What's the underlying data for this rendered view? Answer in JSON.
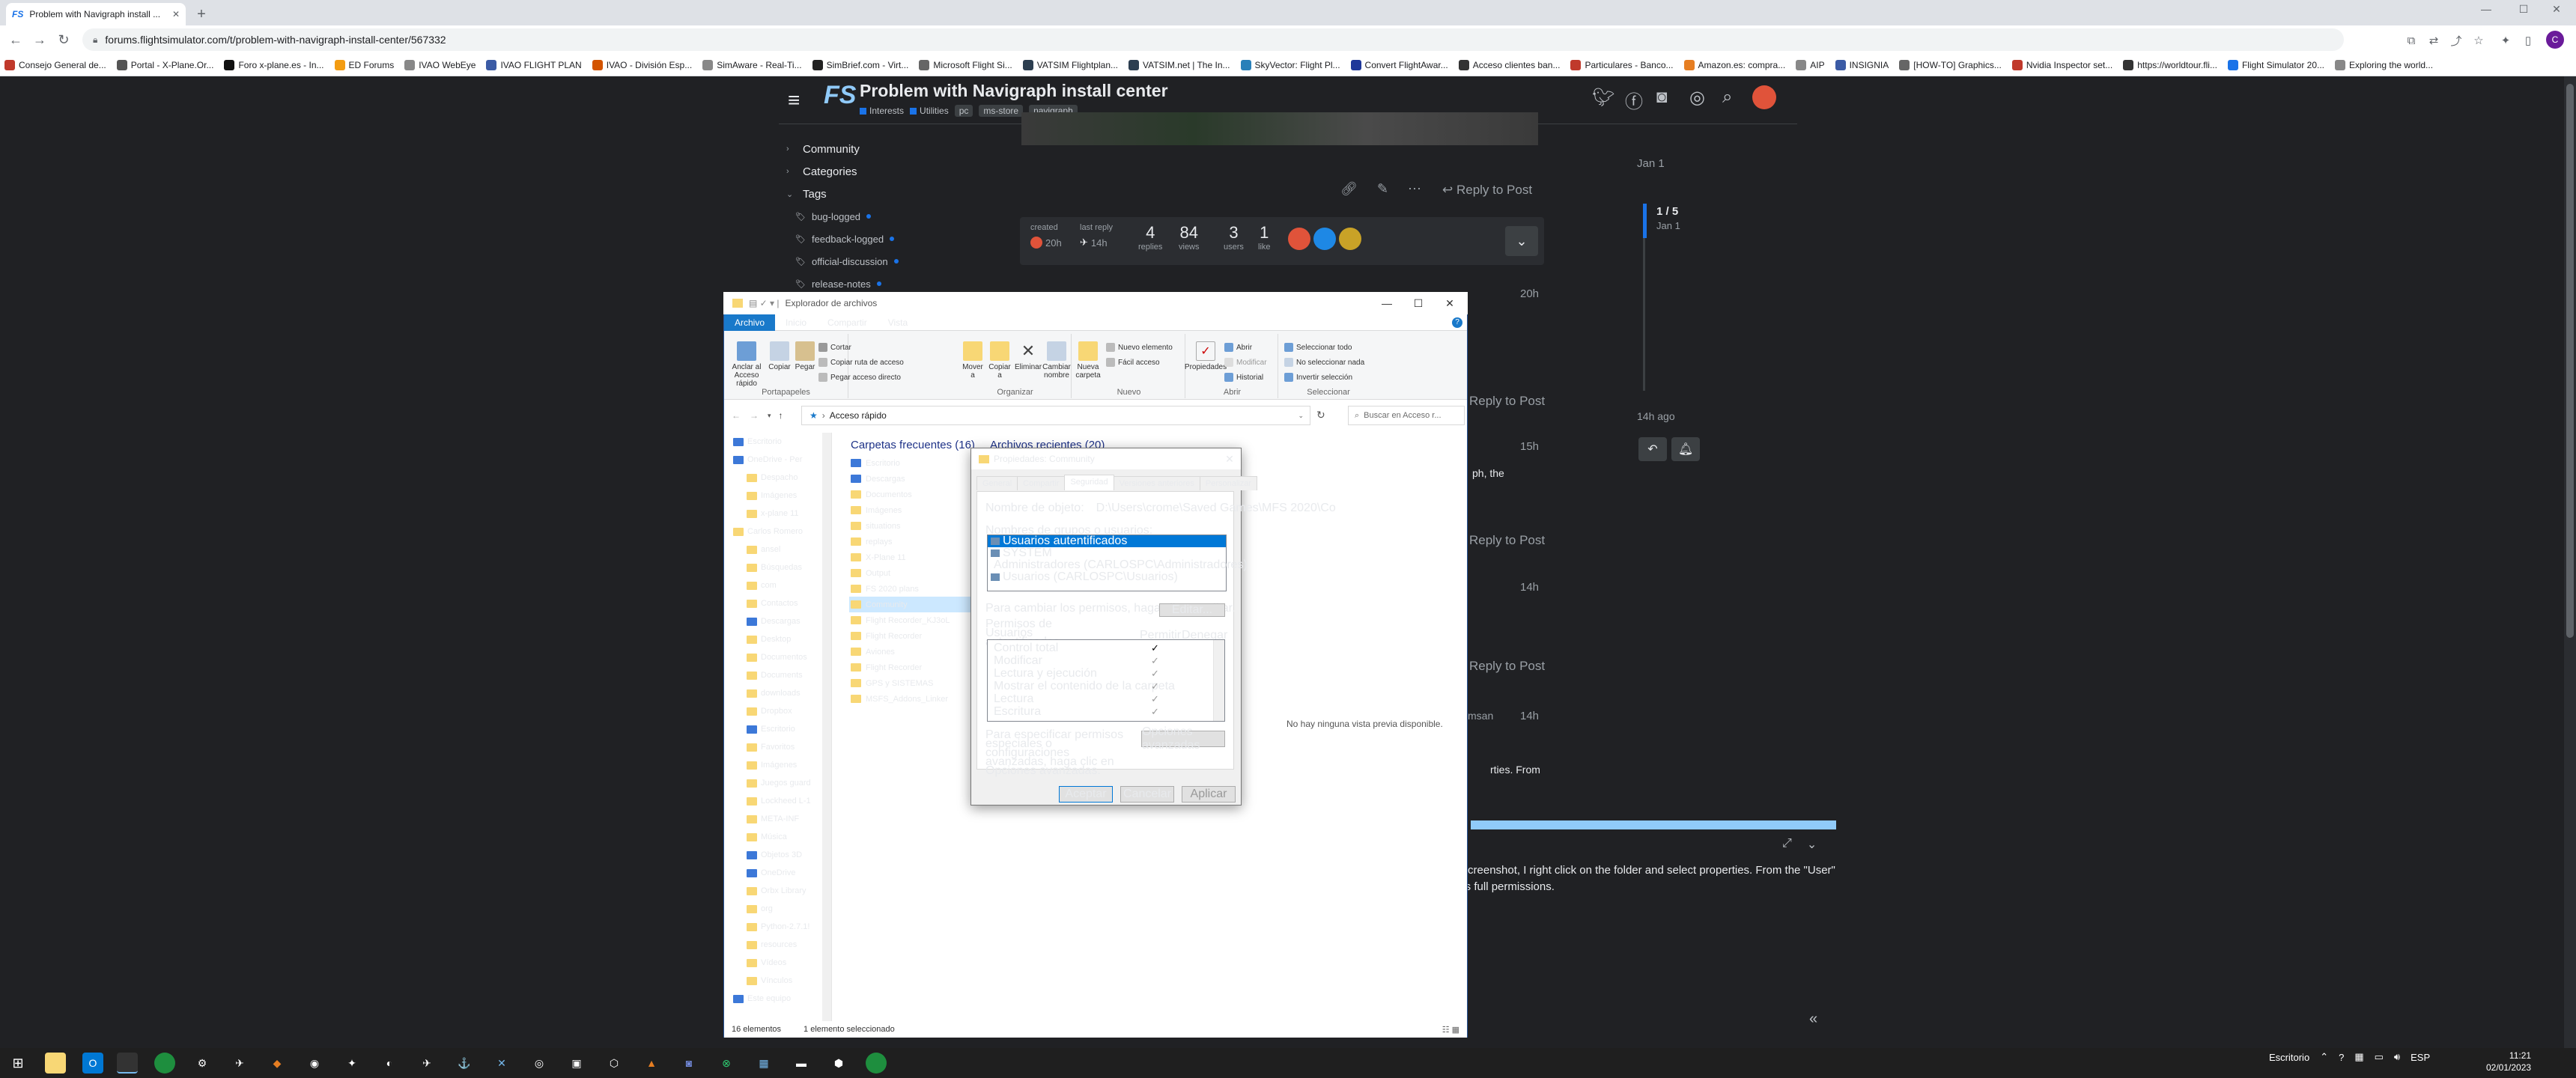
{
  "browser": {
    "tab_title": "Problem with Navigraph install ...",
    "url": "forums.flightsimulator.com/t/problem-with-navigraph-install-center/567332",
    "bookmarks": [
      {
        "label": "Consejo General de...",
        "color": "#c0392b"
      },
      {
        "label": "Portal - X-Plane.Or...",
        "color": "#555555"
      },
      {
        "label": "Foro x-plane.es - In...",
        "color": "#111111"
      },
      {
        "label": "ED Forums",
        "color": "#f39c12"
      },
      {
        "label": "IVAO WebEye",
        "color": "#888888"
      },
      {
        "label": "IVAO FLIGHT PLAN",
        "color": "#3b5ba5"
      },
      {
        "label": "IVAO - División Esp...",
        "color": "#d35400"
      },
      {
        "label": "SimAware - Real-Ti...",
        "color": "#888888"
      },
      {
        "label": "SimBrief.com - Virt...",
        "color": "#222222"
      },
      {
        "label": "Microsoft Flight Si...",
        "color": "#666666"
      },
      {
        "label": "VATSIM Flightplan...",
        "color": "#2c3e50"
      },
      {
        "label": "VATSIM.net | The In...",
        "color": "#2c3e50"
      },
      {
        "label": "SkyVector: Flight Pl...",
        "color": "#2980b9"
      },
      {
        "label": "Convert FlightAwar...",
        "color": "#1e3799"
      },
      {
        "label": "Acceso clientes ban...",
        "color": "#333333"
      },
      {
        "label": "Particulares - Banco...",
        "color": "#c0392b"
      },
      {
        "label": "Amazon.es: compra...",
        "color": "#e67e22"
      },
      {
        "label": "AIP",
        "color": "#888888"
      },
      {
        "label": "INSIGNIA",
        "color": "#3b5ba5"
      },
      {
        "label": "[HOW-TO] Graphics...",
        "color": "#666666"
      },
      {
        "label": "Nvidia Inspector set...",
        "color": "#c0392b"
      },
      {
        "label": "https://worldtour.fli...",
        "color": "#333333"
      },
      {
        "label": "Flight Simulator 20...",
        "color": "#1a73e8"
      },
      {
        "label": "Exploring the world...",
        "color": "#888888"
      }
    ],
    "avatar_letter": "C"
  },
  "forum": {
    "title": "Problem with Navigraph install center",
    "categories": [
      {
        "label": "Interests",
        "color": "#1a73e8"
      },
      {
        "label": "Utilities",
        "color": "#1a73e8"
      }
    ],
    "tags": [
      "pc",
      "ms-store",
      "navigraph"
    ],
    "sidebar": [
      "Community",
      "Categories",
      "Tags"
    ],
    "sidebar_tags": [
      "bug-logged",
      "feedback-logged",
      "official-discussion",
      "release-notes"
    ],
    "reply_label": "Reply to Post",
    "topic_map": {
      "created_label": "created",
      "created_time": "20h",
      "last_reply_label": "last reply",
      "last_reply_time": "14h",
      "replies": "4",
      "replies_label": "replies",
      "views": "84",
      "views_label": "views",
      "users": "3",
      "users_label": "users",
      "likes": "1",
      "likes_label": "like"
    },
    "post_times": [
      "20h",
      "15h",
      "14h",
      "14h"
    ],
    "partial_text_1": "ph, the",
    "partial_text_2": "rties. From",
    "author_partial": "msan",
    "timeline": {
      "top_date": "Jan 1",
      "count": "1 / 5",
      "date": "Jan 1",
      "ago": "14h ago"
    },
    "composer_text": "e screenshot, I right click on the folder and select properties. From the \"User\" has full permissions."
  },
  "explorer": {
    "title": "Explorador de archivos",
    "menu": [
      "Archivo",
      "Inicio",
      "Compartir",
      "Vista"
    ],
    "ribbon": {
      "portapapeles": {
        "label": "Portapapeles",
        "pin": "Anclar al Acceso rápido",
        "copy": "Copiar",
        "paste": "Pegar",
        "cut": "Cortar",
        "copy_path": "Copiar ruta de acceso",
        "paste_shortcut": "Pegar acceso directo"
      },
      "organizar": {
        "label": "Organizar",
        "move": "Mover a",
        "copy_to": "Copiar a",
        "delete": "Eliminar",
        "rename": "Cambiar nombre"
      },
      "nuevo": {
        "label": "Nuevo",
        "new_folder": "Nueva carpeta",
        "new_item": "Nuevo elemento",
        "easy_access": "Fácil acceso"
      },
      "abrir": {
        "label": "Abrir",
        "properties": "Propiedades",
        "open": "Abrir",
        "edit": "Modificar",
        "history": "Historial"
      },
      "seleccionar": {
        "label": "Seleccionar",
        "all": "Seleccionar todo",
        "none": "No seleccionar nada",
        "invert": "Invertir selección"
      }
    },
    "path": "Acceso rápido",
    "search_placeholder": "Buscar en Acceso r...",
    "tree": [
      {
        "label": "Escritorio",
        "blue": true,
        "level": 1
      },
      {
        "label": "OneDrive - Per",
        "blue": true,
        "level": 1
      },
      {
        "label": "Despacho",
        "level": 2
      },
      {
        "label": "Imágenes",
        "level": 2
      },
      {
        "label": "x-plane 11",
        "level": 2
      },
      {
        "label": "Carlos Romero",
        "level": 1
      },
      {
        "label": "ansel",
        "level": 2
      },
      {
        "label": "Búsquedas",
        "level": 2
      },
      {
        "label": "com",
        "level": 2
      },
      {
        "label": "Contactos",
        "level": 2
      },
      {
        "label": "Descargas",
        "blue": true,
        "level": 2
      },
      {
        "label": "Desktop",
        "level": 2
      },
      {
        "label": "Documentos",
        "level": 2
      },
      {
        "label": "Documents",
        "level": 2
      },
      {
        "label": "downloads",
        "level": 2
      },
      {
        "label": "Dropbox",
        "level": 2
      },
      {
        "label": "Escritorio",
        "blue": true,
        "level": 2
      },
      {
        "label": "Favoritos",
        "level": 2
      },
      {
        "label": "Imágenes",
        "level": 2
      },
      {
        "label": "Juegos guard",
        "level": 2
      },
      {
        "label": "Lockheed L-1",
        "level": 2
      },
      {
        "label": "META-INF",
        "level": 2
      },
      {
        "label": "Música",
        "level": 2
      },
      {
        "label": "Objetos 3D",
        "blue": true,
        "level": 2
      },
      {
        "label": "OneDrive",
        "blue": true,
        "level": 2
      },
      {
        "label": "Orbx Library",
        "level": 2
      },
      {
        "label": "org",
        "level": 2
      },
      {
        "label": "Python-2.7.1!",
        "level": 2
      },
      {
        "label": "resources",
        "level": 2
      },
      {
        "label": "Vídeos",
        "level": 2
      },
      {
        "label": "Vínculos",
        "level": 2
      },
      {
        "label": "Este equipo",
        "blue": true,
        "level": 1
      }
    ],
    "frequent_header": "Carpetas frecuentes (16)",
    "recent_header": "Archivos recientes (20)",
    "frequent": [
      {
        "label": "Escritorio",
        "blue": true
      },
      {
        "label": "Descargas",
        "blue": true
      },
      {
        "label": "Documentos"
      },
      {
        "label": "Imágenes"
      },
      {
        "label": "situations"
      },
      {
        "label": "replays"
      },
      {
        "label": "X-Plane 11"
      },
      {
        "label": "Output"
      },
      {
        "label": "FS 2020 plans"
      },
      {
        "label": "Community",
        "selected": true
      },
      {
        "label": "Flight Recorder_KJ3oL"
      },
      {
        "label": "Flight Recorder"
      },
      {
        "label": "Aviones"
      },
      {
        "label": "Flight Recorder"
      },
      {
        "label": "GPS y SISTEMAS"
      },
      {
        "label": "MSFS_Addons_Linker"
      }
    ],
    "preview_text": "No hay ninguna vista previa disponible.",
    "status_items": "16 elementos",
    "status_selected": "1 elemento seleccionado"
  },
  "dialog": {
    "title": "Propiedades: Community",
    "tabs": [
      "General",
      "Compartir",
      "Seguridad",
      "Versiones anteriores",
      "Personalizar"
    ],
    "active_tab": "Seguridad",
    "object_label": "Nombre de objeto:",
    "object_value": "D:\\Users\\crome\\Saved Games\\MFS 2020\\Co",
    "groups_label": "Nombres de grupos o usuarios:",
    "groups": [
      "Usuarios autentificados",
      "SYSTEM",
      "Administradores (CARLOSPC\\Administradores)",
      "Usuarios (CARLOSPC\\Usuarios)"
    ],
    "edit_text": "Para cambiar los permisos, haga clic en Editar.",
    "edit_button": "Editar...",
    "perm_label": "Permisos de Usuarios autentificados",
    "allow_label": "Permitir",
    "deny_label": "Denegar",
    "permissions": [
      {
        "name": "Control total",
        "allow": true
      },
      {
        "name": "Modificar",
        "allow": "grey"
      },
      {
        "name": "Lectura y ejecución",
        "allow": "grey"
      },
      {
        "name": "Mostrar el contenido de la carpeta",
        "allow": "grey"
      },
      {
        "name": "Lectura",
        "allow": "grey"
      },
      {
        "name": "Escritura",
        "allow": "grey"
      }
    ],
    "special_text": "Para especificar permisos especiales o configuraciones avanzadas, haga clic en Opciones avanzadas.",
    "advanced_button": "Opciones avanzadas",
    "ok": "Aceptar",
    "cancel": "Cancelar",
    "apply": "Aplicar"
  },
  "taskbar": {
    "tray_label": "Escritorio",
    "lang": "ESP",
    "time": "11:21",
    "date": "02/01/2023"
  }
}
